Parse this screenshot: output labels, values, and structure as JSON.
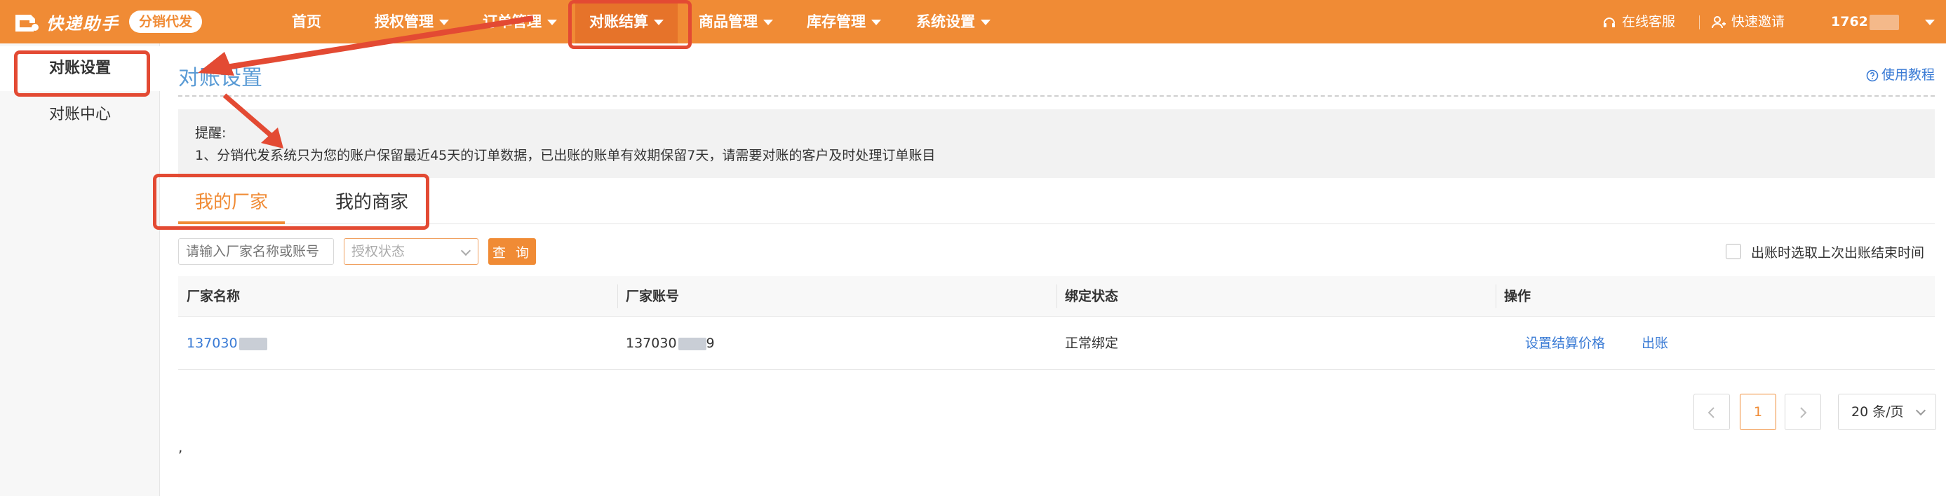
{
  "header": {
    "logo_text": "快递助手",
    "badge": "分销代发",
    "nav": [
      {
        "label": "首页"
      },
      {
        "label": "授权管理"
      },
      {
        "label": "订单管理"
      },
      {
        "label": "对账结算"
      },
      {
        "label": "商品管理"
      },
      {
        "label": "库存管理"
      },
      {
        "label": "系统设置"
      }
    ],
    "online_service": "在线客服",
    "quick_invite": "快速邀请",
    "user_phone": "1762"
  },
  "sidebar": {
    "items": [
      {
        "label": "对账设置",
        "active": true
      },
      {
        "label": "对账中心",
        "active": false
      }
    ]
  },
  "main": {
    "title": "对账设置",
    "help": "使用教程",
    "notice_title": "提醒:",
    "notice_text": "1、分销代发系统只为您的账户保留最近45天的订单数据，已出账的账单有效期保留7天，请需要对账的客户及时处理订单账目",
    "tabs": [
      {
        "label": "我的厂家",
        "active": true
      },
      {
        "label": "我的商家",
        "active": false
      }
    ],
    "filter": {
      "search_placeholder": "请输入厂家名称或账号",
      "status_placeholder": "授权状态",
      "query_button": "查 询",
      "checkbox_label": "出账时选取上次出账结束时间"
    },
    "table": {
      "headers": [
        "厂家名称",
        "厂家账号",
        "绑定状态",
        "操作"
      ],
      "rows": [
        {
          "name": "137030",
          "account": "137030",
          "account_suffix": "9",
          "status": "正常绑定",
          "action_price": "设置结算价格",
          "action_bill": "出账"
        }
      ]
    },
    "pagination": {
      "current": "1",
      "page_size": "20 条/页"
    },
    "stray_mark": ","
  },
  "colors": {
    "accent": "#f08b35",
    "link": "#3a7bd5",
    "highlight": "#e34a33"
  }
}
